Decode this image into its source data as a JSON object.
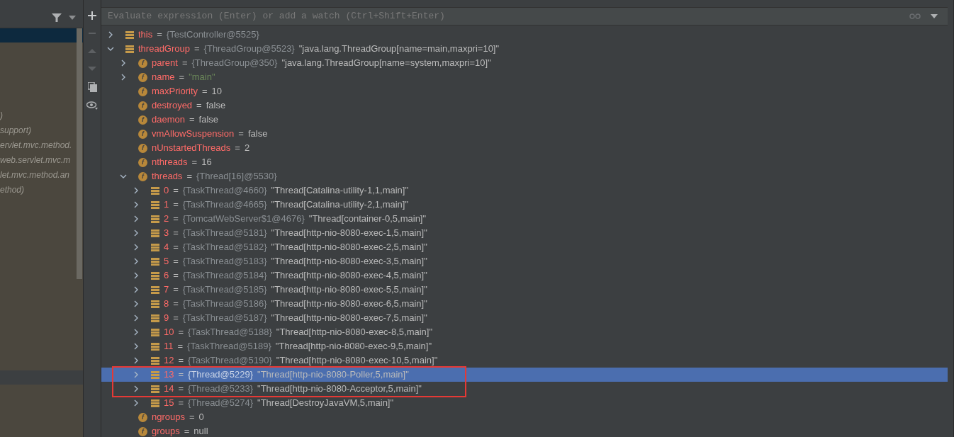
{
  "frames_panel": {
    "frames": [
      {
        "text": ")",
        "selected": false
      },
      {
        "text": "support)",
        "selected": false
      },
      {
        "text": "ervlet.mvc.method.",
        "selected": false
      },
      {
        "text": "web.servlet.mvc.m",
        "selected": false
      },
      {
        "text": "let.mvc.method.an",
        "selected": false
      },
      {
        "text": "ethod)",
        "selected": false
      }
    ]
  },
  "watch_input": {
    "placeholder": "Evaluate expression (Enter) or add a watch (Ctrl+Shift+Enter)"
  },
  "variables": [
    {
      "kind": "object",
      "name": "this",
      "equals": "=",
      "type": "{TestController@5525}",
      "expanded": false,
      "selected": false,
      "boxed": false
    },
    {
      "kind": "object",
      "name": "threadGroup",
      "equals": "=",
      "type": "{ThreadGroup@5523}",
      "value": "\"java.lang.ThreadGroup[name=main,maxpri=10]\"",
      "expanded": true,
      "selected": false,
      "boxed": false,
      "children": [
        {
          "kind": "field",
          "badge": "f",
          "name": "parent",
          "equals": "=",
          "type": "{ThreadGroup@350}",
          "value": "\"java.lang.ThreadGroup[name=system,maxpri=10]\"",
          "expanded": false,
          "selected": false,
          "boxed": false
        },
        {
          "kind": "field",
          "badge": "f",
          "name": "name",
          "equals": "=",
          "string": "\"main\"",
          "expanded": false,
          "selected": false,
          "boxed": false
        },
        {
          "kind": "field",
          "badge": "f",
          "name": "maxPriority",
          "equals": "=",
          "value": "10",
          "selected": false,
          "boxed": false
        },
        {
          "kind": "field",
          "badge": "f",
          "name": "destroyed",
          "equals": "=",
          "value": "false",
          "selected": false,
          "boxed": false
        },
        {
          "kind": "field",
          "badge": "f",
          "name": "daemon",
          "equals": "=",
          "value": "false",
          "selected": false,
          "boxed": false
        },
        {
          "kind": "field",
          "badge": "f",
          "name": "vmAllowSuspension",
          "equals": "=",
          "value": "false",
          "selected": false,
          "boxed": false
        },
        {
          "kind": "field",
          "badge": "f",
          "name": "nUnstartedThreads",
          "equals": "=",
          "value": "2",
          "selected": false,
          "boxed": false
        },
        {
          "kind": "field",
          "badge": "f",
          "name": "nthreads",
          "equals": "=",
          "value": "16",
          "selected": false,
          "boxed": false
        },
        {
          "kind": "field",
          "badge": "f",
          "name": "threads",
          "equals": "=",
          "type": "{Thread[16]@5530}",
          "expanded": true,
          "selected": false,
          "boxed": false,
          "children": [
            {
              "kind": "object",
              "name": "0",
              "equals": "=",
              "type": "{TaskThread@4660}",
              "value": "\"Thread[Catalina-utility-1,1,main]\"",
              "expanded": false,
              "selected": false,
              "boxed": false
            },
            {
              "kind": "object",
              "name": "1",
              "equals": "=",
              "type": "{TaskThread@4665}",
              "value": "\"Thread[Catalina-utility-2,1,main]\"",
              "expanded": false,
              "selected": false,
              "boxed": false
            },
            {
              "kind": "object",
              "name": "2",
              "equals": "=",
              "type": "{TomcatWebServer$1@4676}",
              "value": "\"Thread[container-0,5,main]\"",
              "expanded": false,
              "selected": false,
              "boxed": false
            },
            {
              "kind": "object",
              "name": "3",
              "equals": "=",
              "type": "{TaskThread@5181}",
              "value": "\"Thread[http-nio-8080-exec-1,5,main]\"",
              "expanded": false,
              "selected": false,
              "boxed": false
            },
            {
              "kind": "object",
              "name": "4",
              "equals": "=",
              "type": "{TaskThread@5182}",
              "value": "\"Thread[http-nio-8080-exec-2,5,main]\"",
              "expanded": false,
              "selected": false,
              "boxed": false
            },
            {
              "kind": "object",
              "name": "5",
              "equals": "=",
              "type": "{TaskThread@5183}",
              "value": "\"Thread[http-nio-8080-exec-3,5,main]\"",
              "expanded": false,
              "selected": false,
              "boxed": false
            },
            {
              "kind": "object",
              "name": "6",
              "equals": "=",
              "type": "{TaskThread@5184}",
              "value": "\"Thread[http-nio-8080-exec-4,5,main]\"",
              "expanded": false,
              "selected": false,
              "boxed": false
            },
            {
              "kind": "object",
              "name": "7",
              "equals": "=",
              "type": "{TaskThread@5185}",
              "value": "\"Thread[http-nio-8080-exec-5,5,main]\"",
              "expanded": false,
              "selected": false,
              "boxed": false
            },
            {
              "kind": "object",
              "name": "8",
              "equals": "=",
              "type": "{TaskThread@5186}",
              "value": "\"Thread[http-nio-8080-exec-6,5,main]\"",
              "expanded": false,
              "selected": false,
              "boxed": false
            },
            {
              "kind": "object",
              "name": "9",
              "equals": "=",
              "type": "{TaskThread@5187}",
              "value": "\"Thread[http-nio-8080-exec-7,5,main]\"",
              "expanded": false,
              "selected": false,
              "boxed": false
            },
            {
              "kind": "object",
              "name": "10",
              "equals": "=",
              "type": "{TaskThread@5188}",
              "value": "\"Thread[http-nio-8080-exec-8,5,main]\"",
              "expanded": false,
              "selected": false,
              "boxed": false
            },
            {
              "kind": "object",
              "name": "11",
              "equals": "=",
              "type": "{TaskThread@5189}",
              "value": "\"Thread[http-nio-8080-exec-9,5,main]\"",
              "expanded": false,
              "selected": false,
              "boxed": false
            },
            {
              "kind": "object",
              "name": "12",
              "equals": "=",
              "type": "{TaskThread@5190}",
              "value": "\"Thread[http-nio-8080-exec-10,5,main]\"",
              "expanded": false,
              "selected": false,
              "boxed": false
            },
            {
              "kind": "object",
              "name": "13",
              "equals": "=",
              "type": "{Thread@5229}",
              "value": "\"Thread[http-nio-8080-Poller,5,main]\"",
              "expanded": false,
              "selected": true,
              "boxed": true
            },
            {
              "kind": "object",
              "name": "14",
              "equals": "=",
              "type": "{Thread@5233}",
              "value": "\"Thread[http-nio-8080-Acceptor,5,main]\"",
              "expanded": false,
              "selected": false,
              "boxed": true
            },
            {
              "kind": "object",
              "name": "15",
              "equals": "=",
              "type": "{Thread@5274}",
              "value": "\"Thread[DestroyJavaVM,5,main]\"",
              "expanded": false,
              "selected": false,
              "boxed": false
            }
          ]
        },
        {
          "kind": "field",
          "badge": "f",
          "name": "ngroups",
          "equals": "=",
          "value": "0",
          "selected": false,
          "boxed": false
        },
        {
          "kind": "field",
          "badge": "f",
          "name": "groups",
          "equals": "=",
          "value": "null",
          "selected": false,
          "boxed": false
        }
      ]
    }
  ]
}
